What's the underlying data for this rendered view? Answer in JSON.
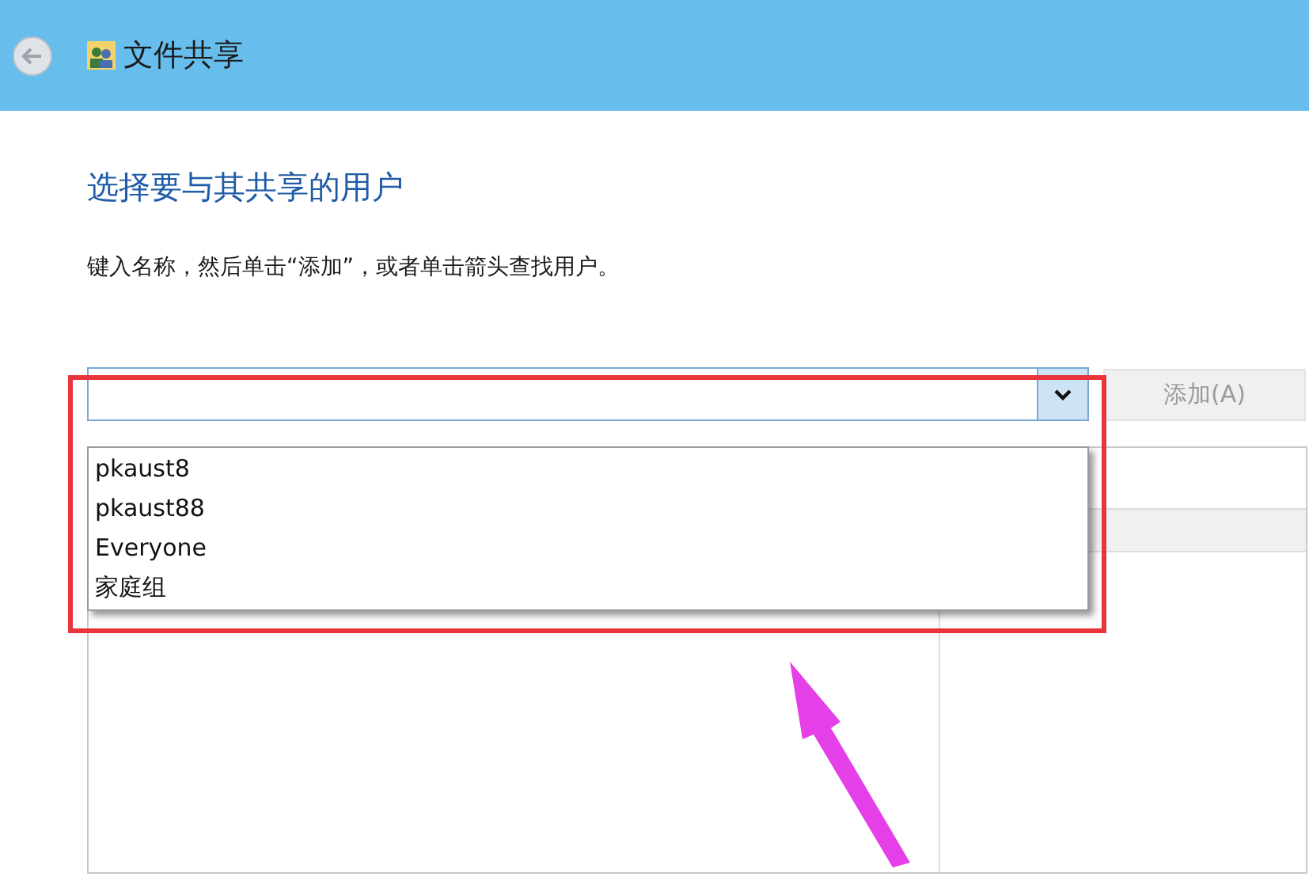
{
  "window": {
    "title": "文件共享"
  },
  "heading": "选择要与其共享的用户",
  "instruction": "键入名称，然后单击“添加”，或者单击箭头查找用户。",
  "name_combo": {
    "expanded": true,
    "options": [
      "pkaust8",
      "pkaust88",
      "Everyone",
      "家庭组"
    ]
  },
  "add_button": {
    "label": "添加(A)",
    "disabled": true
  }
}
